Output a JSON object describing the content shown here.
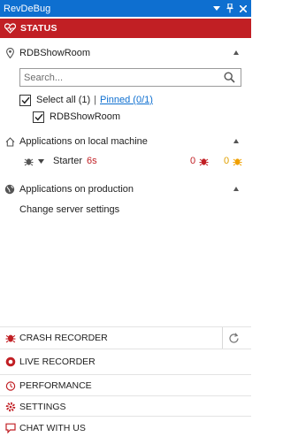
{
  "window": {
    "title": "RevDeBug"
  },
  "status": {
    "label": "STATUS"
  },
  "repo": {
    "name": "RDBShowRoom",
    "search_placeholder": "Search...",
    "select_all_label": "Select all (1)",
    "separator": "|",
    "pinned_label": "Pinned (0/1)",
    "item_label": "RDBShowRoom"
  },
  "local": {
    "heading": "Applications on local machine",
    "app_name": "Starter",
    "app_time": "6s",
    "bugs_count": "0",
    "warnings_count": "0"
  },
  "production": {
    "heading": "Applications on production",
    "change_settings": "Change server settings"
  },
  "nav": {
    "crash_recorder": "CRASH RECORDER",
    "live_recorder": "LIVE RECORDER",
    "performance": "PERFORMANCE",
    "settings": "SETTINGS",
    "chat": "CHAT WITH US"
  },
  "colors": {
    "title_blue": "#0e6fd0",
    "status_red": "#c11f24",
    "accent_red": "#c11f24",
    "warning_orange": "#f0a000"
  }
}
